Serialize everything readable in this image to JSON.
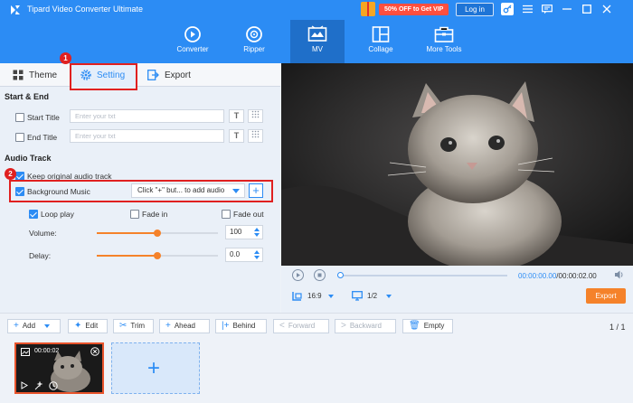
{
  "app": {
    "title": "Tipard Video Converter Ultimate",
    "promo": "50% OFF to Get VIP",
    "login": "Log in"
  },
  "nav": {
    "items": [
      {
        "label": "Converter",
        "icon": "converter-icon"
      },
      {
        "label": "Ripper",
        "icon": "ripper-icon"
      },
      {
        "label": "MV",
        "icon": "mv-icon",
        "active": true
      },
      {
        "label": "Collage",
        "icon": "collage-icon"
      },
      {
        "label": "More Tools",
        "icon": "toolbox-icon"
      }
    ]
  },
  "tabs": {
    "theme": "Theme",
    "setting": "Setting",
    "export": "Export"
  },
  "badges": {
    "one": "1",
    "two": "2"
  },
  "start_end": {
    "title": "Start & End",
    "start_label": "Start Title",
    "end_label": "End Title",
    "placeholder": "Enter your txt",
    "text_btn": "T"
  },
  "audio": {
    "title": "Audio Track",
    "keep_original": "Keep original audio track",
    "background_music": "Background Music",
    "dropdown_value": "Click \"+\" but... to add audio",
    "loop_play": "Loop play",
    "fade_in": "Fade in",
    "fade_out": "Fade out",
    "volume_label": "Volume:",
    "volume_value": "100",
    "volume_level": 0.5,
    "delay_label": "Delay:",
    "delay_value": "0.0",
    "delay_level": 0.5
  },
  "player": {
    "time_current": "00:00:00.00",
    "time_total": "/00:00:02.00",
    "aspect": "16:9",
    "page": "1/2",
    "export": "Export"
  },
  "toolbar": {
    "add": "Add",
    "edit": "Edit",
    "trim": "Trim",
    "ahead": "Ahead",
    "behind": "Behind",
    "forward": "Forward",
    "backward": "Backward",
    "empty": "Empty",
    "page_count": "1 / 1"
  },
  "timeline": {
    "clip_time": "00:00:02"
  },
  "colors": {
    "brand": "#2c8cf4",
    "accent_orange": "#f5822a",
    "highlight_red": "#e02020"
  }
}
